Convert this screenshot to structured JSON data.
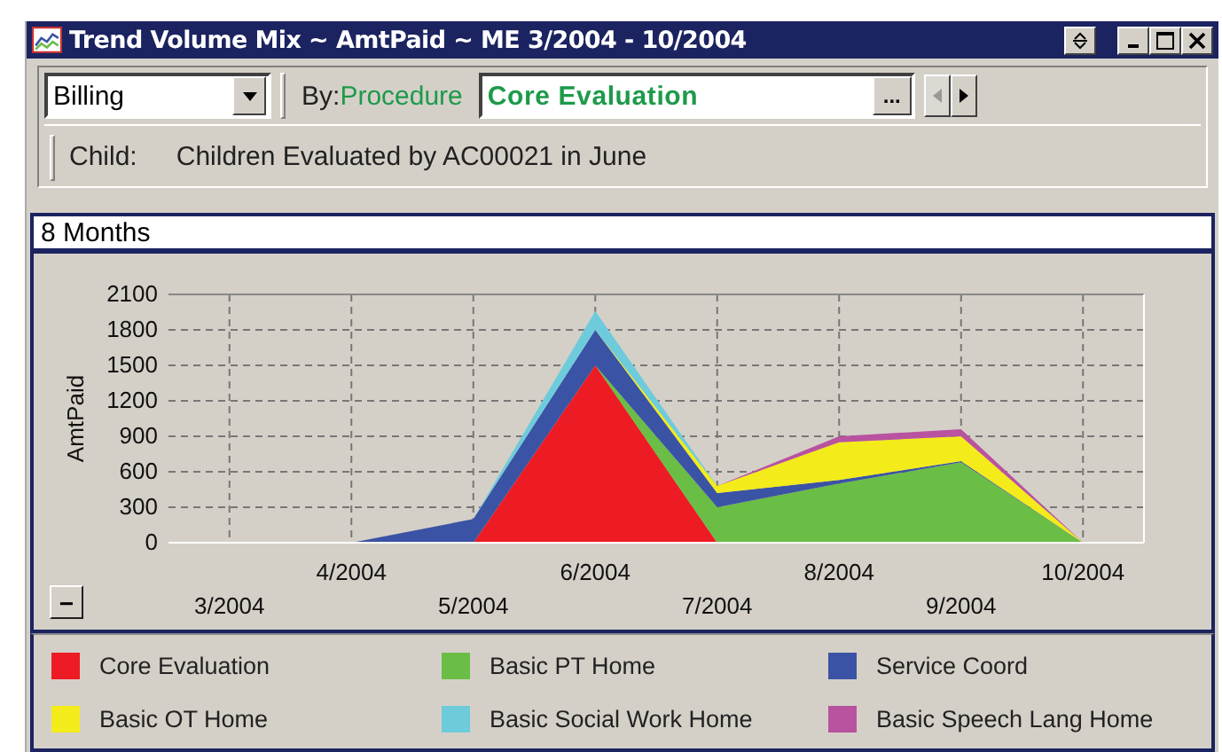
{
  "window": {
    "title": "Trend Volume Mix ~ AmtPaid ~ ME 3/2004 - 10/2004"
  },
  "toolbar": {
    "measure": {
      "value": "Billing"
    },
    "by_label": "By:",
    "by_value": "Procedure",
    "procedure": {
      "value": "Core Evaluation"
    },
    "browse_button": "...",
    "prev_disabled": true,
    "next_disabled": false,
    "child_label": "Child:",
    "child_value": "Children Evaluated by AC00021 in June"
  },
  "period_header": "8 Months",
  "chart_panel": {
    "collapse_button": "−",
    "chart_data": {
      "type": "area",
      "stacked": true,
      "grid": true,
      "ylabel": "AmtPaid",
      "ylim": [
        0,
        2100
      ],
      "yticks": [
        0,
        300,
        600,
        900,
        1200,
        1500,
        1800,
        2100
      ],
      "categories": [
        "3/2004",
        "4/2004",
        "5/2004",
        "6/2004",
        "7/2004",
        "8/2004",
        "9/2004",
        "10/2004"
      ],
      "series": [
        {
          "name": "Core Evaluation",
          "color": "#ed1c24",
          "values": [
            null,
            null,
            0,
            1500,
            0,
            null,
            null,
            null
          ]
        },
        {
          "name": "Basic PT Home",
          "color": "#6abd45",
          "values": [
            null,
            null,
            null,
            0,
            300,
            500,
            680,
            0
          ]
        },
        {
          "name": "Service Coord",
          "color": "#3a53a4",
          "values": [
            null,
            0,
            200,
            300,
            120,
            30,
            10,
            0
          ]
        },
        {
          "name": "Basic OT Home",
          "color": "#f3eb1a",
          "values": [
            null,
            null,
            null,
            0,
            60,
            320,
            210,
            0
          ]
        },
        {
          "name": "Basic Social Work Home",
          "color": "#6dcbdb",
          "values": [
            null,
            null,
            0,
            160,
            0,
            null,
            null,
            null
          ]
        },
        {
          "name": "Basic Speech Lang Home",
          "color": "#b9529f",
          "values": [
            null,
            null,
            null,
            null,
            0,
            50,
            60,
            0
          ]
        }
      ]
    }
  }
}
